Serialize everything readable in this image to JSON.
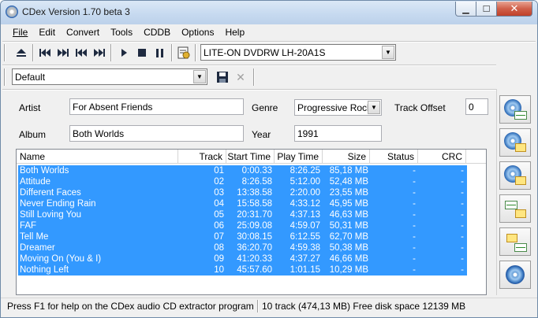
{
  "window": {
    "title": "CDex Version 1.70 beta 3"
  },
  "menu": [
    {
      "label": "File"
    },
    {
      "label": "Edit"
    },
    {
      "label": "Convert"
    },
    {
      "label": "Tools"
    },
    {
      "label": "CDDB"
    },
    {
      "label": "Options"
    },
    {
      "label": "Help"
    }
  ],
  "toolbar": {
    "drive": "LITE-ON DVDRW LH-20A1S",
    "profile": "Default"
  },
  "form": {
    "artist_label": "Artist",
    "artist_value": "For Absent Friends",
    "album_label": "Album",
    "album_value": "Both Worlds",
    "genre_label": "Genre",
    "genre_value": "Progressive Rock",
    "year_label": "Year",
    "year_value": "1991",
    "track_offset_label": "Track Offset",
    "track_offset_value": "0"
  },
  "list": {
    "columns": [
      "Name",
      "Track",
      "Start Time",
      "Play Time",
      "Size",
      "Status",
      "CRC"
    ],
    "rows": [
      {
        "name": "Both Worlds",
        "track": "01",
        "start": "0:00.33",
        "play": "8:26.25",
        "size": "85,18 MB",
        "status": "-",
        "crc": "-"
      },
      {
        "name": "Attitude",
        "track": "02",
        "start": "8:26.58",
        "play": "5:12.00",
        "size": "52,48 MB",
        "status": "-",
        "crc": "-"
      },
      {
        "name": "Different Faces",
        "track": "03",
        "start": "13:38.58",
        "play": "2:20.00",
        "size": "23,55 MB",
        "status": "-",
        "crc": "-"
      },
      {
        "name": "Never Ending Rain",
        "track": "04",
        "start": "15:58.58",
        "play": "4:33.12",
        "size": "45,95 MB",
        "status": "-",
        "crc": "-"
      },
      {
        "name": "Still Loving You",
        "track": "05",
        "start": "20:31.70",
        "play": "4:37.13",
        "size": "46,63 MB",
        "status": "-",
        "crc": "-"
      },
      {
        "name": "FAF",
        "track": "06",
        "start": "25:09.08",
        "play": "4:59.07",
        "size": "50,31 MB",
        "status": "-",
        "crc": "-"
      },
      {
        "name": "Tell Me",
        "track": "07",
        "start": "30:08.15",
        "play": "6:12.55",
        "size": "62,70 MB",
        "status": "-",
        "crc": "-"
      },
      {
        "name": "Dreamer",
        "track": "08",
        "start": "36:20.70",
        "play": "4:59.38",
        "size": "50,38 MB",
        "status": "-",
        "crc": "-"
      },
      {
        "name": "Moving On (You & I)",
        "track": "09",
        "start": "41:20.33",
        "play": "4:37.27",
        "size": "46,66 MB",
        "status": "-",
        "crc": "-"
      },
      {
        "name": "Nothing Left",
        "track": "10",
        "start": "45:57.60",
        "play": "1:01.15",
        "size": "10,29 MB",
        "status": "-",
        "crc": "-"
      }
    ]
  },
  "status": {
    "help": "Press F1 for help on the CDex audio CD extractor program",
    "summary": "10 track (474,13 MB) Free disk space 12139 MB"
  },
  "colors": {
    "selection": "#3399ff",
    "titlebar": "#c7daf0",
    "close": "#c0412a"
  }
}
